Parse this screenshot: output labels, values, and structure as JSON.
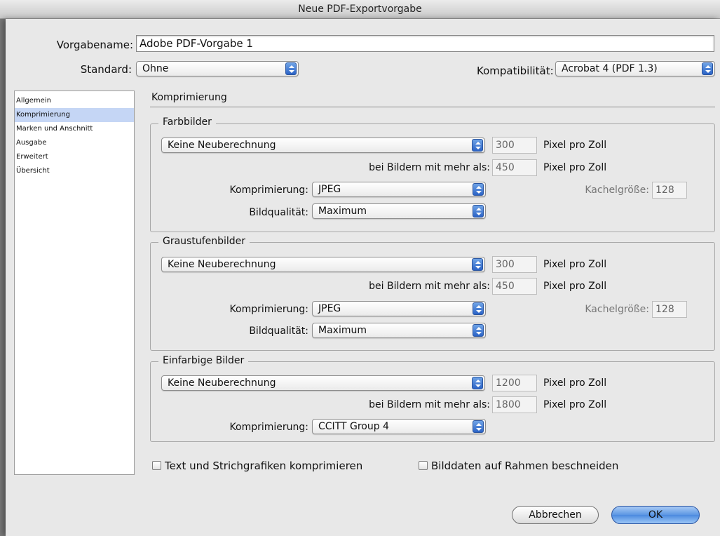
{
  "window": {
    "title": "Neue PDF-Exportvorgabe"
  },
  "header": {
    "preset_label": "Vorgabename:",
    "preset_value": "Adobe PDF-Vorgabe 1",
    "standard_label": "Standard:",
    "standard_value": "Ohne",
    "compat_label": "Kompatibilität:",
    "compat_value": "Acrobat 4 (PDF 1.3)"
  },
  "sidebar": {
    "items": [
      {
        "label": "Allgemein"
      },
      {
        "label": "Komprimierung"
      },
      {
        "label": "Marken und Anschnitt"
      },
      {
        "label": "Ausgabe"
      },
      {
        "label": "Erweitert"
      },
      {
        "label": "Übersicht"
      }
    ],
    "selected": "Komprimierung"
  },
  "section_title": "Komprimierung",
  "common": {
    "ppi": "Pixel pro Zoll",
    "above": "bei Bildern mit mehr als:",
    "compression": "Komprimierung:",
    "quality": "Bildqualität:",
    "tile": "Kachelgröße:"
  },
  "color": {
    "title": "Farbbilder",
    "resample": "Keine Neuberechnung",
    "ppi": "300",
    "above_ppi": "450",
    "compression": "JPEG",
    "quality": "Maximum",
    "tile": "128"
  },
  "gray": {
    "title": "Graustufenbilder",
    "resample": "Keine Neuberechnung",
    "ppi": "300",
    "above_ppi": "450",
    "compression": "JPEG",
    "quality": "Maximum",
    "tile": "128"
  },
  "mono": {
    "title": "Einfarbige Bilder",
    "resample": "Keine Neuberechnung",
    "ppi": "1200",
    "above_ppi": "1800",
    "compression": "CCITT Group 4"
  },
  "options": {
    "compress_text": "Text und Strichgrafiken komprimieren",
    "crop_images": "Bilddaten auf Rahmen beschneiden"
  },
  "buttons": {
    "cancel": "Abbrechen",
    "ok": "OK"
  }
}
